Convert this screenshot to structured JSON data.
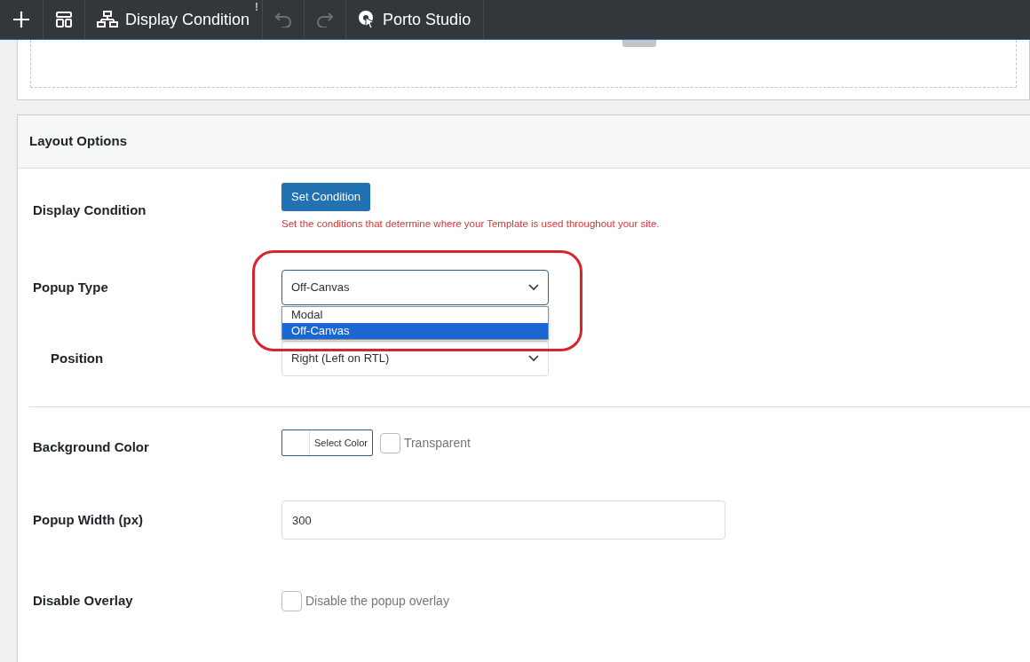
{
  "toolbar": {
    "items": [
      {
        "kind": "plus",
        "disabled": false
      },
      {
        "kind": "layout",
        "disabled": false
      },
      {
        "kind": "condition",
        "label": "Display Condition",
        "disabled": false,
        "alert_mark": "!"
      },
      {
        "kind": "undo",
        "disabled": true
      },
      {
        "kind": "redo",
        "disabled": true
      },
      {
        "kind": "studio",
        "label": "Porto Studio",
        "disabled": false
      }
    ]
  },
  "layout_options": {
    "title": "Layout Options",
    "rows": [
      {
        "kind": "button",
        "label": "Display Condition",
        "button": "Set Condition",
        "help": "Set the conditions that determine where your Template is used throughout your site."
      },
      {
        "kind": "select",
        "label": "Popup Type",
        "value": "Off-Canvas",
        "expanded": true,
        "highlighted": true,
        "options": [
          {
            "label": "Modal",
            "selected": false
          },
          {
            "label": "Off-Canvas",
            "selected": true
          }
        ]
      },
      {
        "kind": "select",
        "label": "Position",
        "indented": true,
        "value": "Right (Left on RTL)",
        "expanded": false
      },
      {
        "kind": "divider"
      },
      {
        "kind": "color",
        "label": "Background Color",
        "button": "Select Color",
        "checkbox": {
          "label": "Transparent",
          "checked": false
        }
      },
      {
        "kind": "input",
        "label": "Popup Width (px)",
        "value": "300"
      },
      {
        "kind": "checkbox",
        "label": "Disable Overlay",
        "checkbox": {
          "label": "Disable the popup overlay",
          "checked": false
        }
      }
    ]
  }
}
